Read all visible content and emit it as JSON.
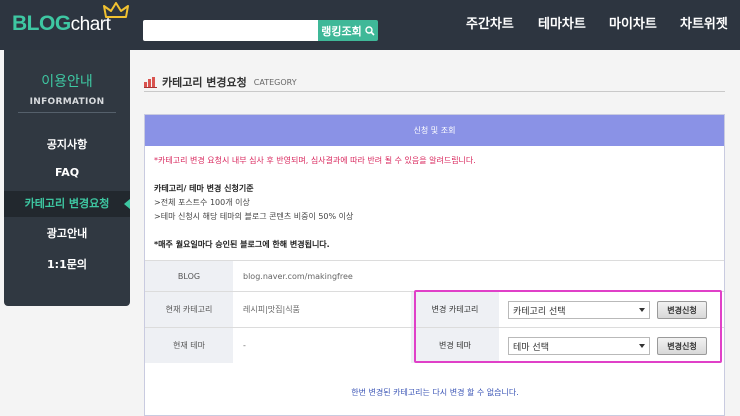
{
  "header": {
    "logo_main": "BLOG",
    "logo_sub": "chart",
    "search": {
      "placeholder": "",
      "button_label": "랭킹조회"
    },
    "nav": [
      "주간차트",
      "테마차트",
      "마이차트",
      "차트위젯"
    ]
  },
  "sidebar": {
    "title": "이용안내",
    "subtitle": "INFORMATION",
    "items": [
      {
        "label": "공지사항",
        "active": false
      },
      {
        "label": "FAQ",
        "active": false
      },
      {
        "label": "카테고리 변경요청",
        "active": true
      },
      {
        "label": "광고안내",
        "active": false
      },
      {
        "label": "1:1문의",
        "active": false
      }
    ]
  },
  "page": {
    "title": "카테고리 변경요청",
    "title_en": "CATEGORY",
    "panel_header": "신청 및 조회",
    "notice": "*카테고리 변경 요청시 내부 심사 후 반영되며, 심사결과에 따라 반려 될 수 있음을 알려드립니다.",
    "criteria_title": "카테고리/ 테마 변경 신청기준",
    "criteria": [
      ">전체 포스트수 100개 이상",
      ">테마 신청시 해당 테마의 블로그 콘텐츠 비중이 50% 이상"
    ],
    "criteria_note": "*매주 월요일마다 승인된 블로그에 한해 변경됩니다.",
    "blog": {
      "label": "BLOG",
      "value": "blog.naver.com/makingfree"
    },
    "current_category": {
      "label": "현재 카테고리",
      "value": "레시피|맛집|식품"
    },
    "current_theme": {
      "label": "현재 테마",
      "value": "-"
    },
    "change_category": {
      "label": "변경 카테고리",
      "selected": "카테고리 선택",
      "button": "변경신청"
    },
    "change_theme": {
      "label": "변경 테마",
      "selected": "테마 선택",
      "button": "변경신청"
    },
    "bottom_note": "한번 변경된 카테고리는 다시 변경 할 수 없습니다."
  },
  "colors": {
    "topbar": "#2d3540",
    "accent": "#3ec7a2",
    "panel_header": "#8a92e6",
    "highlight": "#e040c8",
    "notice_red": "#d9275d"
  }
}
